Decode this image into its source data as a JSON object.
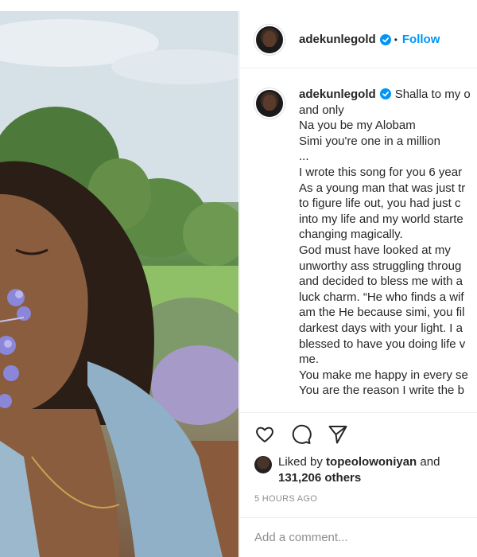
{
  "post": {
    "photo_alt": "photo",
    "username": "adekunlegold",
    "separator": "•",
    "follow_label": "Follow",
    "caption_lines": [
      "Shalla to my o",
      "and only",
      "Na you be my Alobam",
      "Simi you're one in a million",
      "...",
      "I wrote this song for you 6 year",
      "As a young man that was just tr",
      "to figure life out, you had just c",
      "into my life and my world starte",
      "changing magically.",
      "God must have looked at my",
      "unworthy ass struggling throug",
      "and decided to bless me with a",
      "luck charm. “He who finds a wif",
      "am the He because simi, you fil",
      "darkest days with your light. I a",
      "blessed to have you doing life v",
      "me.",
      "You make me happy in every se",
      "You are the reason I write the b"
    ],
    "liked_prefix": "Liked by",
    "liked_user": "topeolowoniyan",
    "liked_and": "and",
    "liked_others": "131,206 others",
    "time_ago": "5 HOURS AGO",
    "comment_placeholder": "Add a comment..."
  },
  "icons": {
    "verified": "verified-badge-icon",
    "like": "heart-icon",
    "comment": "comment-bubble-icon",
    "share": "paper-plane-icon"
  },
  "colors": {
    "accent": "#0095f6",
    "text": "#262626",
    "muted": "#8e8e8e",
    "border": "#efefef"
  }
}
